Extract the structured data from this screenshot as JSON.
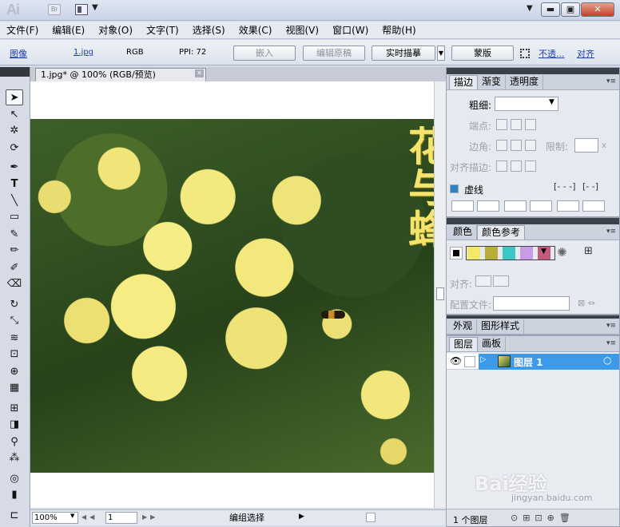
{
  "app": {
    "logo": "Ai",
    "bridge_badge": "Br"
  },
  "menu": [
    "文件(F)",
    "编辑(E)",
    "对象(O)",
    "文字(T)",
    "选择(S)",
    "效果(C)",
    "视图(V)",
    "窗口(W)",
    "帮助(H)"
  ],
  "controlbar": {
    "type_link": "图像",
    "file_link": "1.jpg",
    "mode": "RGB",
    "ppi": "PPI: 72",
    "embed": "嵌入",
    "edit_original": "编辑原稿",
    "live_trace": "实时描摹",
    "mask": "蒙版",
    "opacity_link": "不透...",
    "align_link": "对齐"
  },
  "document": {
    "tab_title": "1.jpg* @ 100% (RGB/预览)",
    "artwork_text": "花与蜂"
  },
  "status": {
    "zoom": "100%",
    "page": "1",
    "mode": "编组选择"
  },
  "stroke_panel": {
    "tabs": [
      "描边",
      "渐变",
      "透明度"
    ],
    "weight_label": "粗细:",
    "cap_label": "端点:",
    "corner_label": "边角:",
    "limit_label": "限制:",
    "limit_suffix": "x",
    "align_label": "对齐描边:",
    "dashed_label": "虚线"
  },
  "color_panel": {
    "tabs": [
      "颜色",
      "颜色参考"
    ],
    "swatch_colors": [
      "#f4e86a",
      "#b9ad3a",
      "#3cc7c4",
      "#c79be6",
      "#c25a7c"
    ],
    "align_label": "对齐:",
    "profile_label": "配置文件:"
  },
  "appearance_panel": {
    "tabs": [
      "外观",
      "图形样式"
    ]
  },
  "layers_panel": {
    "tabs": [
      "图层",
      "画板"
    ],
    "layer_name": "图层 1",
    "footer": "1 个图层"
  },
  "watermark": {
    "main": "Bai经验",
    "sub": "jingyan.baidu.com"
  }
}
